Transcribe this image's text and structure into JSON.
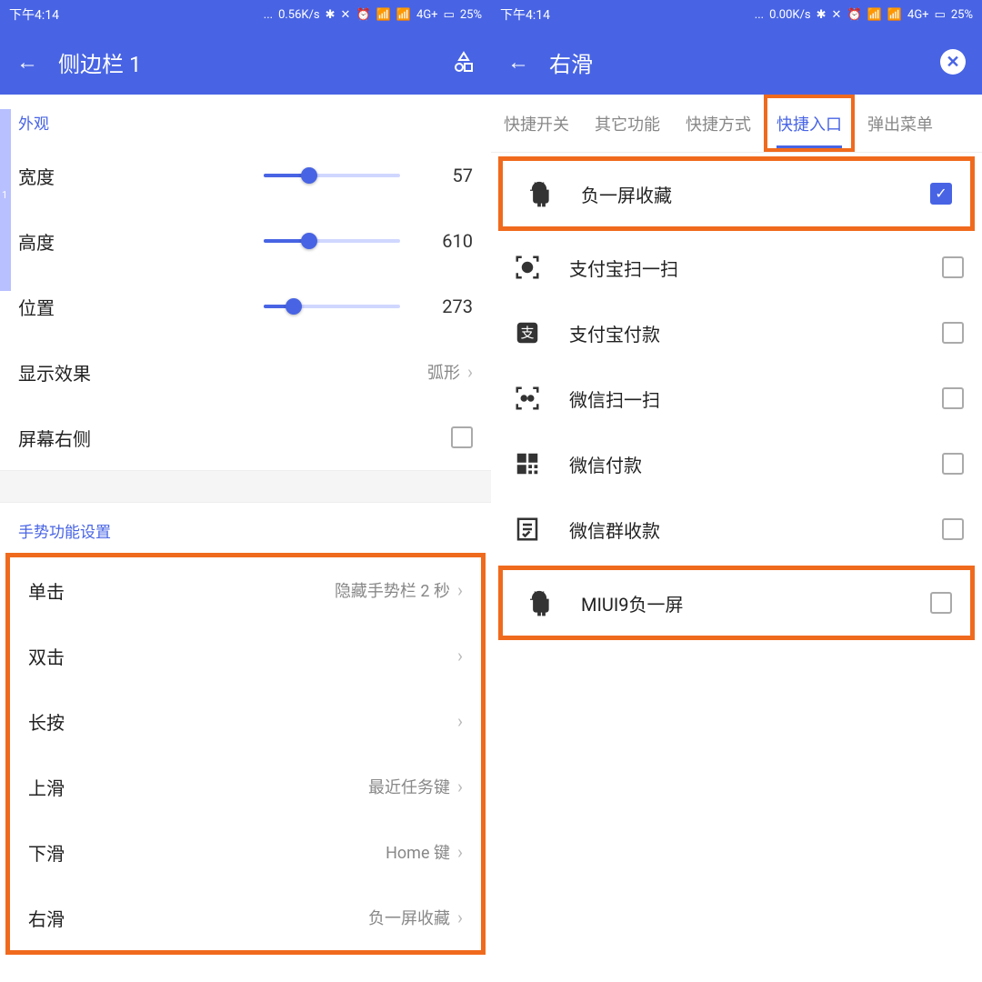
{
  "left": {
    "status": {
      "time": "下午4:14",
      "speed": "0.56K/s",
      "net": "4G+",
      "battery": "25%"
    },
    "appbar": {
      "title": "侧边栏 1"
    },
    "indicator_label": "1",
    "sections": {
      "appearance": "外观",
      "gestures": "手势功能设置"
    },
    "sliders": {
      "width": {
        "label": "宽度",
        "value": 57,
        "pct": 33
      },
      "height": {
        "label": "高度",
        "value": 610,
        "pct": 33
      },
      "pos": {
        "label": "位置",
        "value": 273,
        "pct": 22
      }
    },
    "display_effect": {
      "label": "显示效果",
      "value": "弧形"
    },
    "screen_right": {
      "label": "屏幕右侧",
      "checked": false
    },
    "gesture_rows": [
      {
        "key": "tap",
        "label": "单击",
        "value": "隐藏手势栏 2 秒"
      },
      {
        "key": "dbltap",
        "label": "双击",
        "value": ""
      },
      {
        "key": "longpress",
        "label": "长按",
        "value": ""
      },
      {
        "key": "swipeup",
        "label": "上滑",
        "value": "最近任务键"
      },
      {
        "key": "swipedown",
        "label": "下滑",
        "value": "Home 键"
      },
      {
        "key": "swiperight",
        "label": "右滑",
        "value": "负一屏收藏"
      }
    ]
  },
  "right": {
    "status": {
      "time": "下午4:14",
      "speed": "0.00K/s",
      "net": "4G+",
      "battery": "25%"
    },
    "appbar": {
      "title": "右滑"
    },
    "tabs": [
      "快捷开关",
      "其它功能",
      "快捷方式",
      "快捷入口",
      "弹出菜单"
    ],
    "tabs_active_index": 3,
    "items": [
      {
        "key": "fav",
        "label": "负一屏收藏",
        "icon": "android",
        "checked": true,
        "hl": true
      },
      {
        "key": "alibascan",
        "label": "支付宝扫一扫",
        "icon": "scan",
        "checked": false,
        "hl": false
      },
      {
        "key": "alibapay",
        "label": "支付宝付款",
        "icon": "pay",
        "checked": false,
        "hl": false
      },
      {
        "key": "wxscan",
        "label": "微信扫一扫",
        "icon": "scan2",
        "checked": false,
        "hl": false
      },
      {
        "key": "wxpay",
        "label": "微信付款",
        "icon": "qr",
        "checked": false,
        "hl": false
      },
      {
        "key": "wxgroup",
        "label": "微信群收款",
        "icon": "receipt",
        "checked": false,
        "hl": false
      },
      {
        "key": "miui9",
        "label": "MIUI9负一屏",
        "icon": "android",
        "checked": false,
        "hl": true
      }
    ]
  }
}
